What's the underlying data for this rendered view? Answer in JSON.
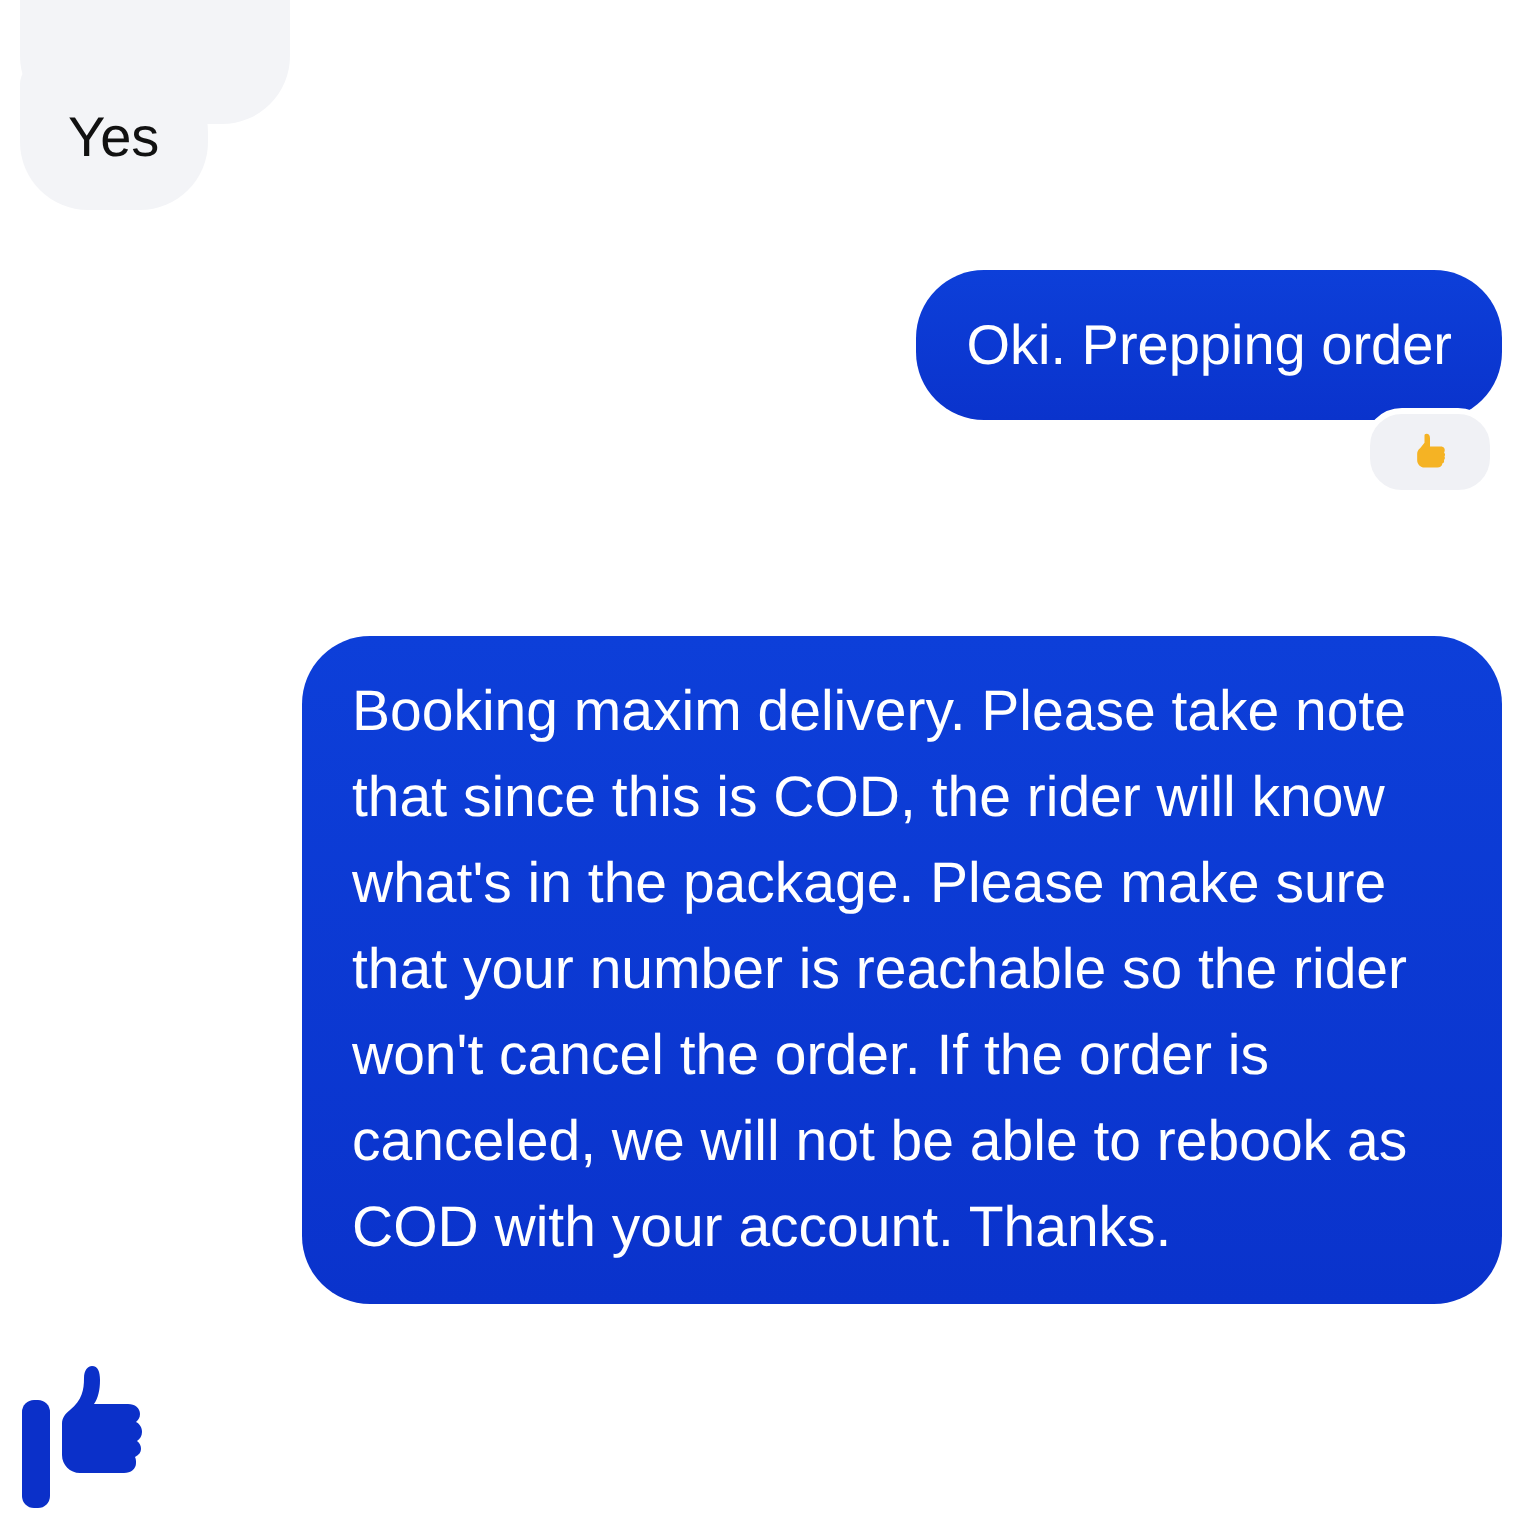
{
  "messages": [
    {
      "kind": "incoming",
      "text": "Yes"
    },
    {
      "kind": "outgoing",
      "text": "Oki. Prepping order",
      "reaction": true
    },
    {
      "kind": "outgoing",
      "text": "Booking maxim delivery. Please take note that since this is COD, the rider will know what's in the package. Please make sure that your number is reachable so the rider won't cancel the order. If the order is canceled, we will not be able to rebook as COD with your account. Thanks.",
      "reaction": false
    }
  ]
}
